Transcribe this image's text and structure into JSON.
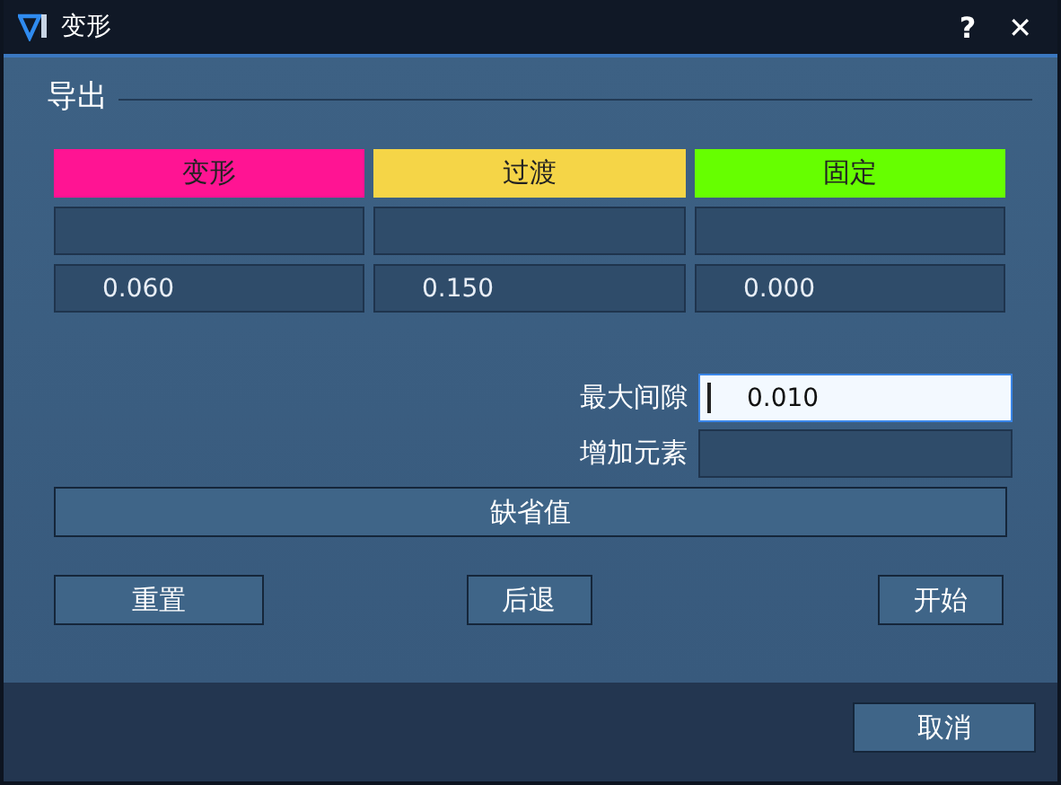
{
  "window": {
    "title": "变形",
    "help": "?",
    "close": "✕"
  },
  "section": {
    "title": "导出"
  },
  "columns": [
    {
      "label": "变形",
      "color": "#ff1493",
      "value": "0.060"
    },
    {
      "label": "过渡",
      "color": "#f5d547",
      "value": "0.150"
    },
    {
      "label": "固定",
      "color": "#66ff00",
      "value": "0.000"
    }
  ],
  "fields": [
    {
      "label": "最大间隙",
      "value": "0.010",
      "focused": true
    },
    {
      "label": "增加元素",
      "focused": false
    }
  ],
  "default_button": "缺省值",
  "actions": [
    "重置",
    "后退",
    "开始"
  ],
  "footer": {
    "cancel": "取消"
  }
}
